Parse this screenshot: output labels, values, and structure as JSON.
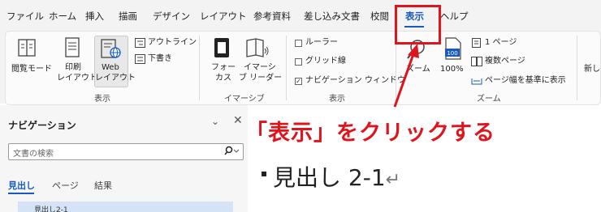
{
  "menu": {
    "items": [
      "ファイル",
      "ホーム",
      "挿入",
      "描画",
      "デザイン",
      "レイアウト",
      "参考資料",
      "差し込み文書",
      "校閲",
      "表示",
      "ヘルプ"
    ]
  },
  "ribbon": {
    "view_group": {
      "read_mode": "閲覧モード",
      "print_layout_line1": "印刷",
      "print_layout_line2": "レイアウト",
      "web_layout_line1": "Web",
      "web_layout_line2": "レイアウト",
      "outline": "アウトライン",
      "draft": "下書き",
      "label": "表示"
    },
    "immersive_group": {
      "focus_line1": "フォー",
      "focus_line2": "カス",
      "reader_line1": "イマーシ",
      "reader_line2": "ブ リーダー",
      "label": "イマーシブ"
    },
    "show_group": {
      "ruler": "ルーラー",
      "gridlines": "グリッド線",
      "nav_pane": "ナビゲーション ウィンドウ",
      "ruler_checked": false,
      "gridlines_checked": false,
      "nav_pane_checked": true,
      "label": "表示"
    },
    "zoom_group": {
      "zoom": "ズーム",
      "percent": "100%",
      "one_page": "1 ページ",
      "multi_page": "複数ページ",
      "page_width": "ページ幅を基準に表示",
      "label": "ズーム"
    },
    "new_window_partial": "新し"
  },
  "nav_pane": {
    "title": "ナビゲーション",
    "search_placeholder": "文書の検索",
    "tabs": [
      "見出し",
      "ページ",
      "結果"
    ],
    "items": [
      "見出し2-1"
    ]
  },
  "document": {
    "heading": "見出し 2-1",
    "paragraph_mark": "↵"
  },
  "annotation": {
    "text": "「表示」をクリックする",
    "color": "#e0141c"
  },
  "colors": {
    "accent": "#185abd",
    "highlight": "#e0141c"
  }
}
